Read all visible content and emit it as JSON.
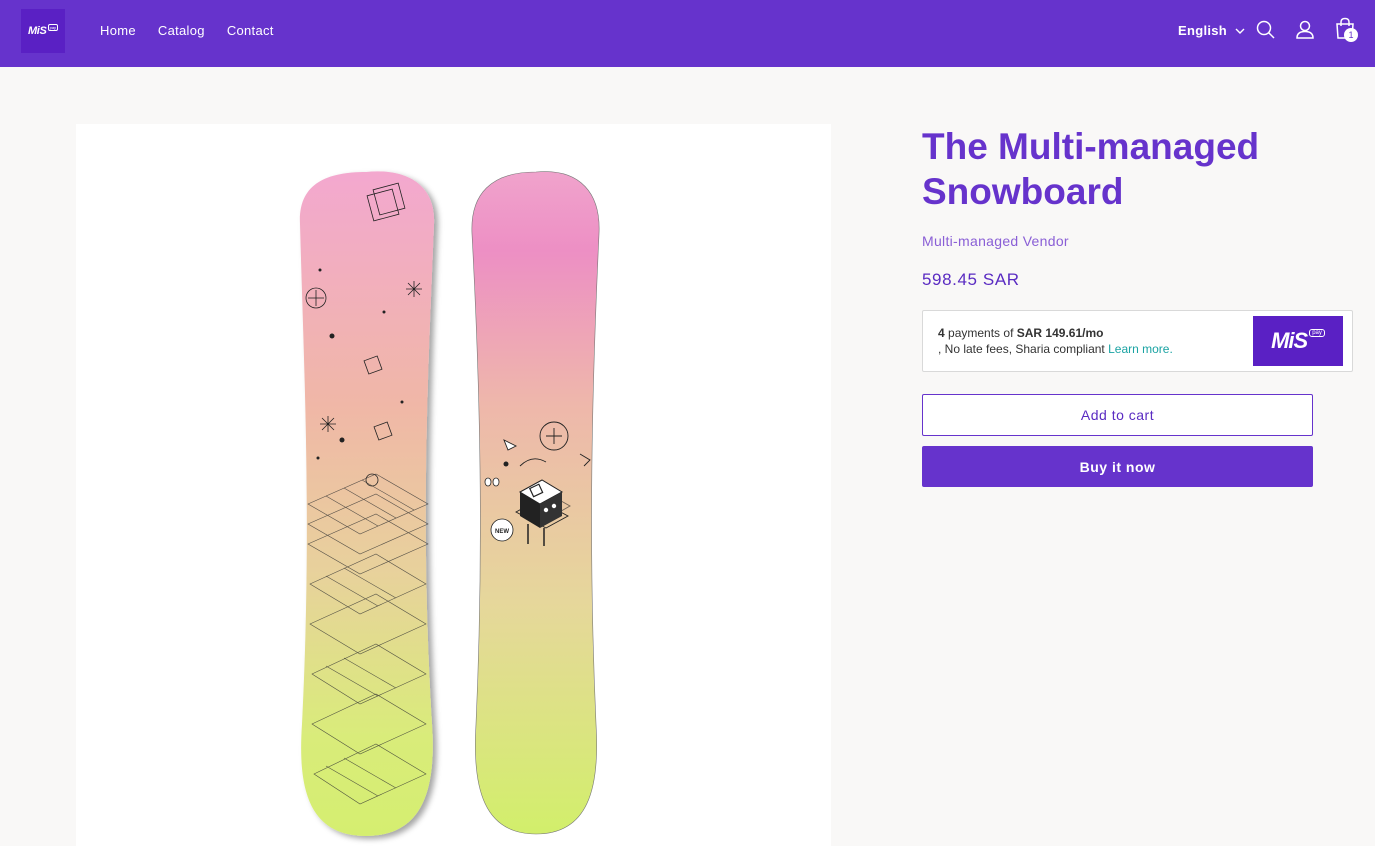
{
  "header": {
    "logo_text": "MiS",
    "logo_sup": "pay",
    "nav": [
      {
        "label": "Home"
      },
      {
        "label": "Catalog"
      },
      {
        "label": "Contact"
      }
    ],
    "language": "English",
    "cart_count": "1",
    "icons": [
      "search-icon",
      "account-icon",
      "cart-icon",
      "chevron-down-icon"
    ]
  },
  "product": {
    "title": "The Multi-managed Snowboard",
    "vendor": "Multi-managed Vendor",
    "price": "598.45 SAR",
    "image_badge": "NEW"
  },
  "bnpl": {
    "installments": "4",
    "payments_of": "payments of",
    "amount": "SAR 149.61/mo",
    "line2": ", No late fees, Sharia compliant",
    "learn_more": "Learn more.",
    "logo_text": "MiS",
    "logo_sup": "pay"
  },
  "buttons": {
    "add_to_cart": "Add to cart",
    "buy_now": "Buy it now"
  },
  "colors": {
    "brand": "#6633cc",
    "link": "#1aa3a3",
    "background": "#f9f8f7"
  }
}
